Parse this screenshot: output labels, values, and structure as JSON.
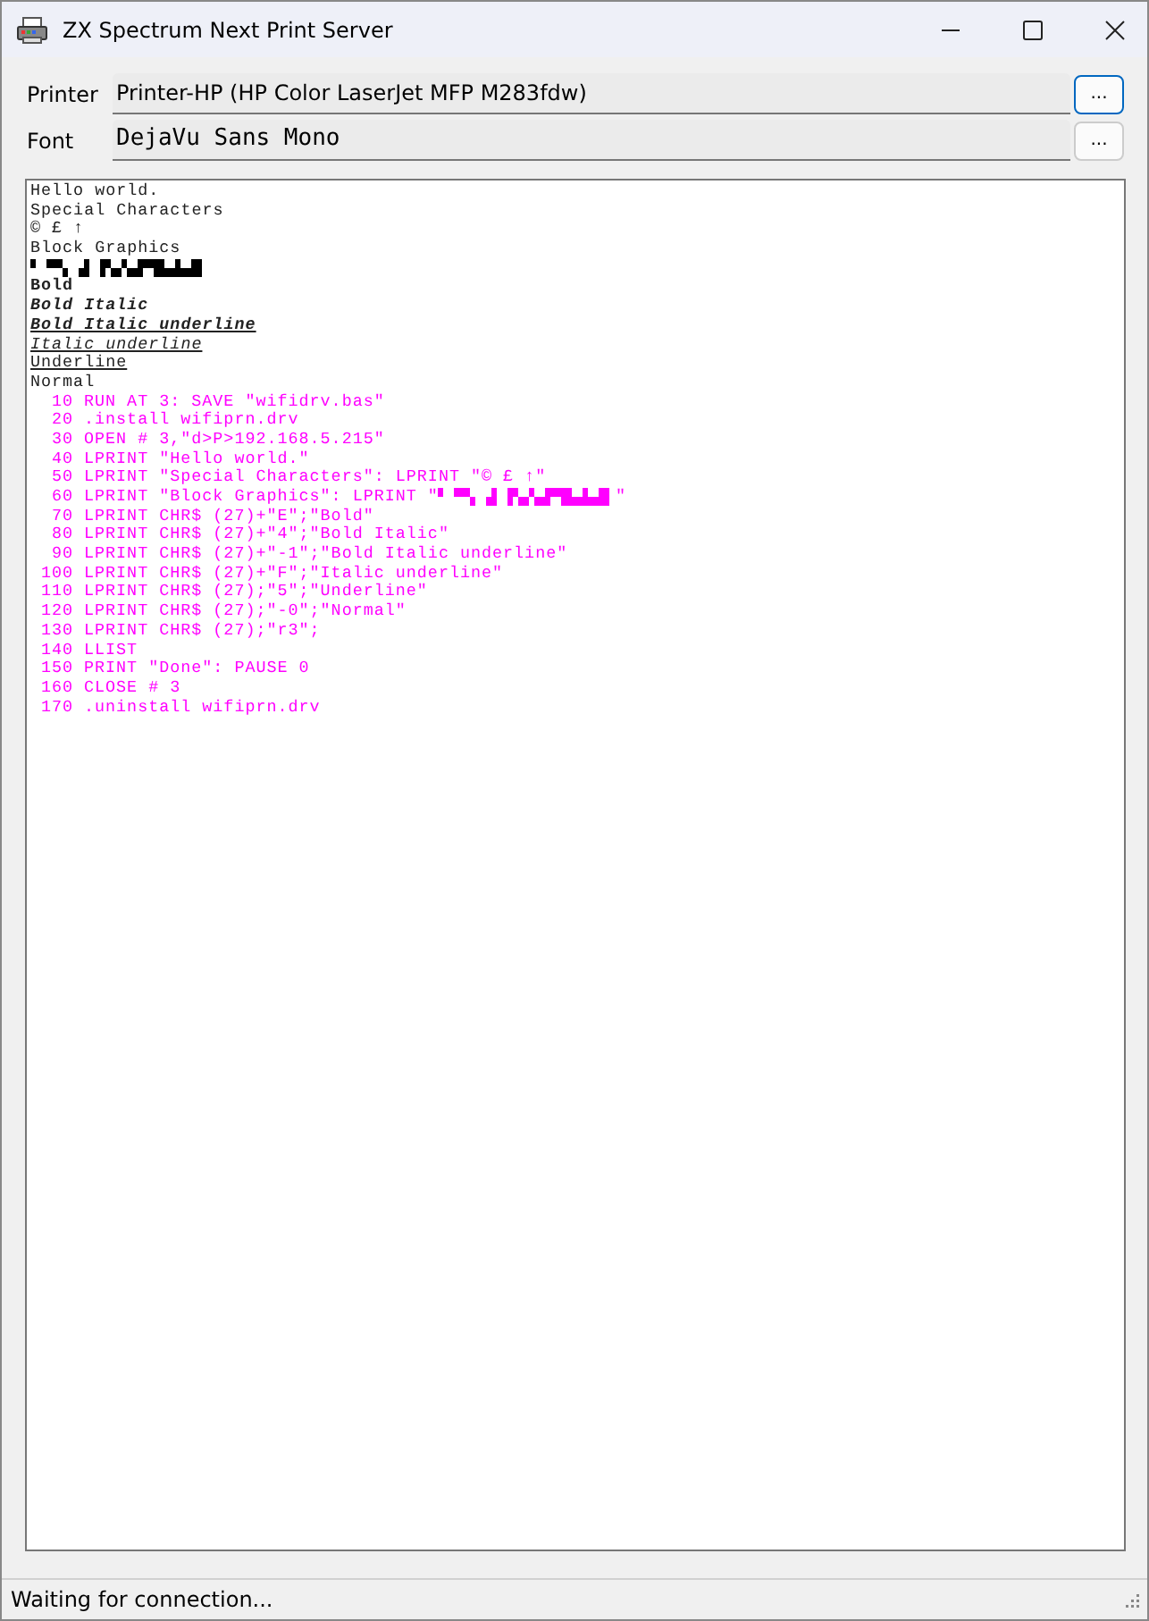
{
  "window": {
    "title": "ZX Spectrum Next Print Server"
  },
  "fields": [
    {
      "label": "Printer",
      "value": "Printer-HP (HP Color LaserJet MFP M283fdw)",
      "kind": "proportional",
      "button": "...",
      "focused": true
    },
    {
      "label": "Font",
      "value": "DejaVu Sans Mono",
      "kind": "mono",
      "button": "...",
      "focused": false
    }
  ],
  "output": [
    {
      "kind": "text",
      "text": "Hello world.",
      "bold": false,
      "italic": false,
      "underline": false
    },
    {
      "kind": "text",
      "text": "Special Characters",
      "bold": false,
      "italic": false,
      "underline": false
    },
    {
      "kind": "text",
      "text": "© £ ↑",
      "bold": false,
      "italic": false,
      "underline": false
    },
    {
      "kind": "text",
      "text": "Block Graphics",
      "bold": false,
      "italic": false,
      "underline": false
    },
    {
      "kind": "graphics"
    },
    {
      "kind": "text",
      "text": "Bold",
      "bold": true,
      "italic": false,
      "underline": false
    },
    {
      "kind": "text",
      "text": "Bold Italic",
      "bold": true,
      "italic": true,
      "underline": false
    },
    {
      "kind": "text",
      "text": "Bold Italic underline",
      "bold": true,
      "italic": true,
      "underline": true
    },
    {
      "kind": "text",
      "text": "Italic underline",
      "bold": false,
      "italic": true,
      "underline": true
    },
    {
      "kind": "text",
      "text": "Underline",
      "bold": false,
      "italic": false,
      "underline": true
    },
    {
      "kind": "text",
      "text": "Normal",
      "bold": false,
      "italic": false,
      "underline": false
    }
  ],
  "listing": [
    {
      "number": "10",
      "code": "RUN AT 3: SAVE \"wifidrv.bas\""
    },
    {
      "number": "20",
      "code": ".install wifiprn.drv"
    },
    {
      "number": "30",
      "code": "OPEN # 3,\"d>P>192.168.5.215\""
    },
    {
      "number": "40",
      "code": "LPRINT \"Hello world.\""
    },
    {
      "number": "50",
      "code": "LPRINT \"Special Characters\": LPRINT \"© £ ↑\""
    },
    {
      "number": "60",
      "code": "LPRINT \"Block Graphics\": LPRINT \"",
      "graphics": true,
      "code_after": "\""
    },
    {
      "number": "70",
      "code": "LPRINT CHR$ (27)+\"E\";\"Bold\""
    },
    {
      "number": "80",
      "code": "LPRINT CHR$ (27)+\"4\";\"Bold Italic\""
    },
    {
      "number": "90",
      "code": "LPRINT CHR$ (27)+\"-1\";\"Bold Italic underline\""
    },
    {
      "number": "100",
      "code": "LPRINT CHR$ (27)+\"F\";\"Italic underline\""
    },
    {
      "number": "110",
      "code": "LPRINT CHR$ (27);\"5\";\"Underline\""
    },
    {
      "number": "120",
      "code": "LPRINT CHR$ (27);\"-0\";\"Normal\""
    },
    {
      "number": "130",
      "code": "LPRINT CHR$ (27);\"r3\";"
    },
    {
      "number": "140",
      "code": "LLIST"
    },
    {
      "number": "150",
      "code": "PRINT \"Done\": PAUSE 0"
    },
    {
      "number": "160",
      "code": "CLOSE # 3"
    },
    {
      "number": "170",
      "code": ".uninstall wifiprn.drv"
    }
  ],
  "status_bar": {
    "text": "Waiting for connection..."
  }
}
